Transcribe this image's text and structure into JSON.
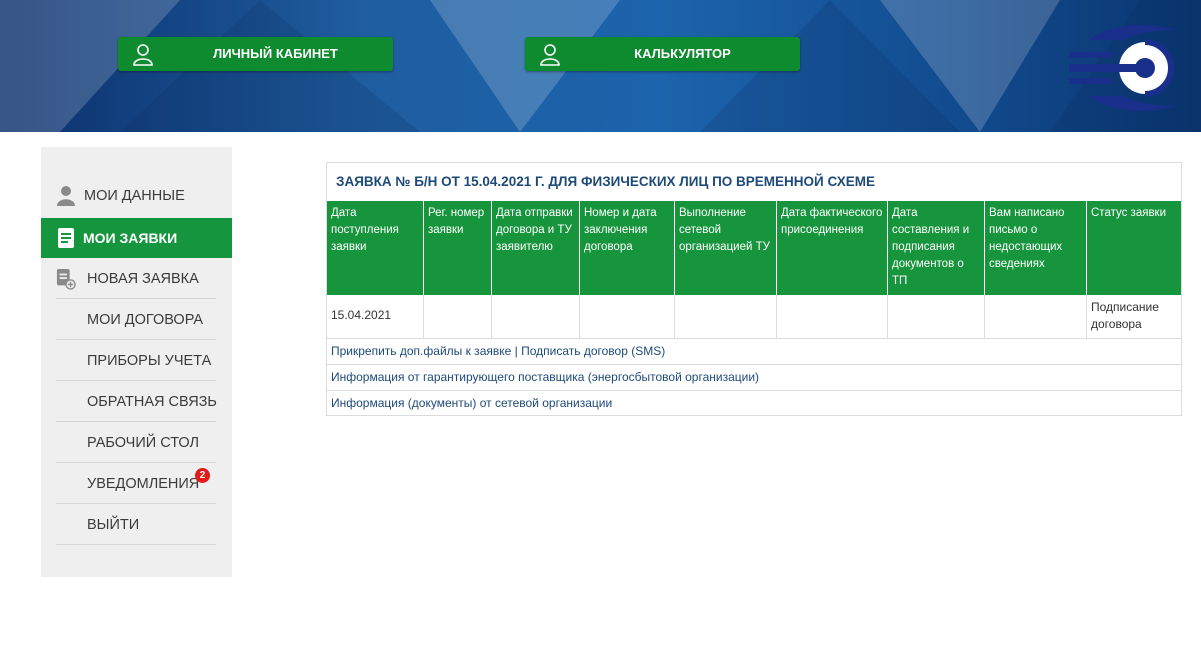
{
  "colors": {
    "header_blue": "#1c64ad",
    "accent_green": "#15963e",
    "title_blue": "#1e4a78",
    "badge_red": "#e21b1b",
    "sidebar_bg": "#efefef"
  },
  "header": {
    "buttons": [
      {
        "label": "ЛИЧНЫЙ КАБИНЕТ",
        "icon": "user-icon"
      },
      {
        "label": "КАЛЬКУЛЯТОР",
        "icon": "user-icon"
      }
    ],
    "logo_icon": "company-logo"
  },
  "sidebar": {
    "items": [
      {
        "label": "МОИ ДАННЫЕ",
        "icon": "user-icon",
        "active": false
      },
      {
        "label": "МОИ ЗАЯВКИ",
        "icon": "document-icon",
        "active": true
      },
      {
        "label": "НОВАЯ ЗАЯВКА",
        "icon": "new-document-icon",
        "active": false
      },
      {
        "label": "МОИ ДОГОВОРА",
        "active": false
      },
      {
        "label": "ПРИБОРЫ УЧЕТА",
        "active": false
      },
      {
        "label": "ОБРАТНАЯ СВЯЗЬ",
        "active": false
      },
      {
        "label": "РАБОЧИЙ СТОЛ",
        "active": false
      },
      {
        "label": "УВЕДОМЛЕНИЯ",
        "badge": "2",
        "active": false
      },
      {
        "label": "ВЫЙТИ",
        "active": false
      }
    ]
  },
  "request": {
    "title": "ЗАЯВКА № Б/Н ОТ 15.04.2021 Г. ДЛЯ ФИЗИЧЕСКИХ ЛИЦ ПО ВРЕМЕННОЙ СХЕМЕ",
    "columns": [
      "Дата поступления заявки",
      "Рег. номер заявки",
      "Дата отправки договора и ТУ заявителю",
      "Номер и дата заключения договора",
      "Выполнение сетевой организацией ТУ",
      "Дата фактического присоединения",
      "Дата составления и подписания документов о ТП",
      "Вам написано письмо о недостающих сведениях",
      "Статус заявки"
    ],
    "row": [
      "15.04.2021",
      "",
      "",
      "",
      "",
      "",
      "",
      "",
      "Подписание договора"
    ],
    "links": {
      "attach": "Прикрепить доп.файлы к заявке",
      "separator": "|",
      "sign": "Подписать договор (SMS)",
      "supplier_info": "Информация от гарантирующего поставщика (энергосбытовой организации)",
      "grid_info": "Информация (документы) от сетевой организации"
    }
  }
}
